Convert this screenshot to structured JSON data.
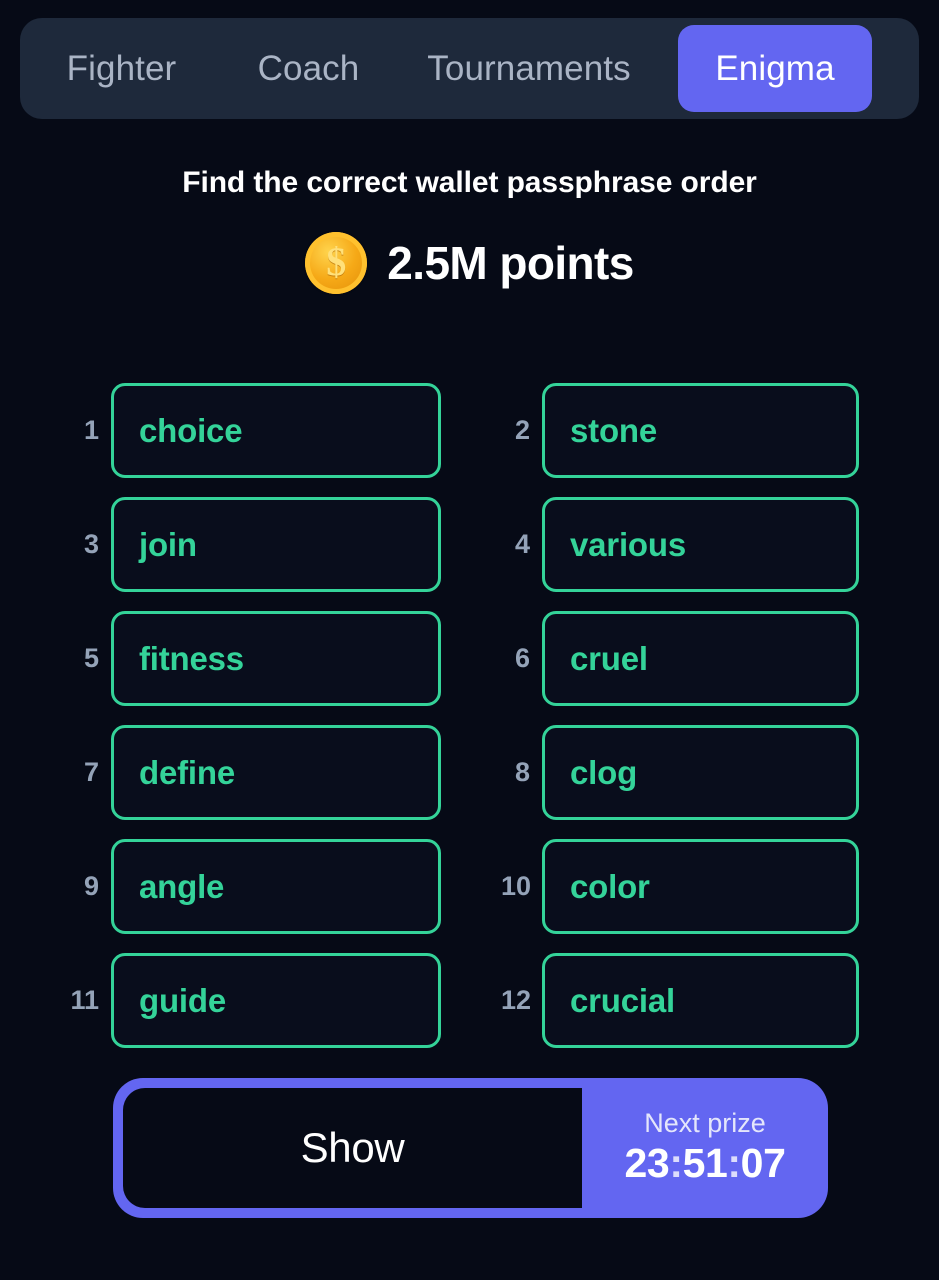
{
  "app": {
    "background_color": "#060a16",
    "accent_color": "#6366f1",
    "word_color": "#34d399"
  },
  "tabs": {
    "items": [
      {
        "label": "Fighter",
        "active": false
      },
      {
        "label": "Coach",
        "active": false
      },
      {
        "label": "Tournaments",
        "active": false
      },
      {
        "label": "Enigma",
        "active": true
      }
    ]
  },
  "header": {
    "headline": "Find the correct wallet passphrase order",
    "coin_icon": "coin-dollar-icon",
    "prize_amount": "2.5M points"
  },
  "passphrase": {
    "words": [
      {
        "index": "1",
        "word": "choice"
      },
      {
        "index": "2",
        "word": "stone"
      },
      {
        "index": "3",
        "word": "join"
      },
      {
        "index": "4",
        "word": "various"
      },
      {
        "index": "5",
        "word": "fitness"
      },
      {
        "index": "6",
        "word": "cruel"
      },
      {
        "index": "7",
        "word": "define"
      },
      {
        "index": "8",
        "word": "clog"
      },
      {
        "index": "9",
        "word": "angle"
      },
      {
        "index": "10",
        "word": "color"
      },
      {
        "index": "11",
        "word": "guide"
      },
      {
        "index": "12",
        "word": "crucial"
      }
    ]
  },
  "footer": {
    "show_label": "Show",
    "next_prize_label": "Next prize",
    "timer": {
      "hours": "23",
      "minutes": "51",
      "seconds": "07",
      "separator": ":",
      "full": "23:51:07"
    }
  }
}
